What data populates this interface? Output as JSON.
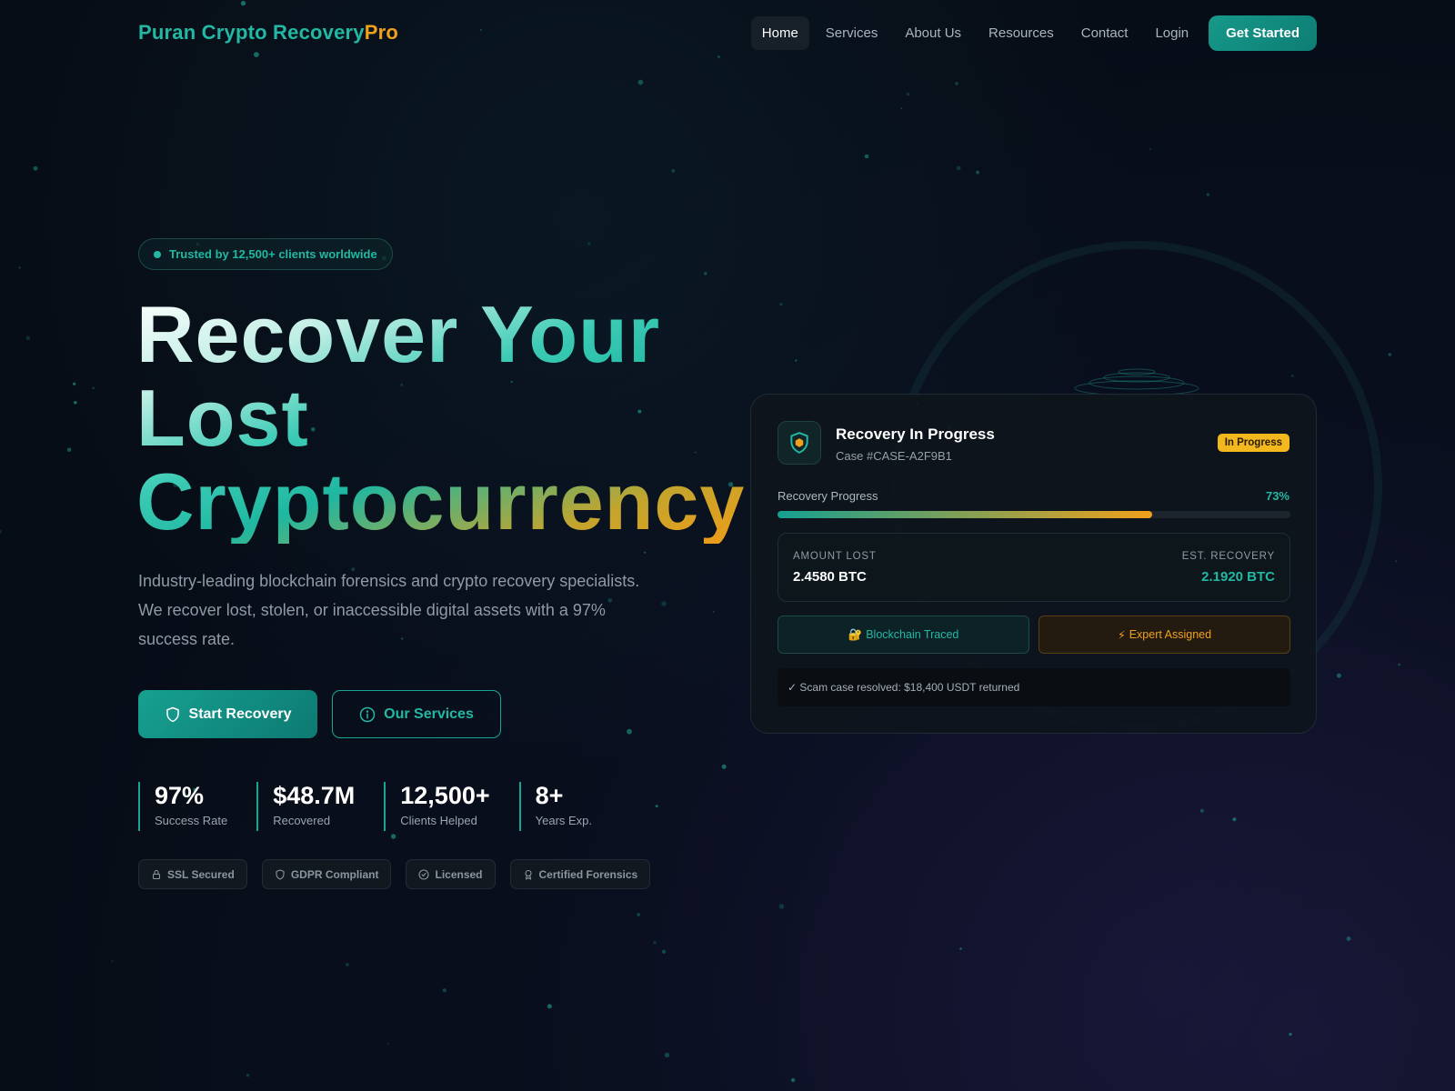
{
  "brand": {
    "name": "Puran Crypto Recovery",
    "suffix": "Pro"
  },
  "nav": {
    "links": [
      "Home",
      "Services",
      "About Us",
      "Resources",
      "Contact",
      "Login"
    ],
    "active": "Home",
    "cta": "Get Started"
  },
  "hero": {
    "trust_badge": "Trusted by 12,500+ clients worldwide",
    "headline_lines": [
      "Recover Your",
      "Lost",
      "Cryptocurrency"
    ],
    "subtext": "Industry-leading blockchain forensics and crypto recovery specialists. We recover lost, stolen, or inaccessible digital assets with a 97% success rate.",
    "primary_button": "Start Recovery",
    "secondary_button": "Our Services"
  },
  "stats": [
    {
      "value": "97%",
      "label": "Success Rate"
    },
    {
      "value": "$48.7M",
      "label": "Recovered"
    },
    {
      "value": "12,500+",
      "label": "Clients Helped"
    },
    {
      "value": "8+",
      "label": "Years Exp."
    }
  ],
  "trust_badges": [
    "SSL Secured",
    "GDPR Compliant",
    "Licensed",
    "Certified Forensics"
  ],
  "recovery_card": {
    "title": "Recovery In Progress",
    "case_id": "Case #CASE-A2F9B1",
    "status": "In Progress",
    "progress_label": "Recovery Progress",
    "progress_percent": 73,
    "progress_text": "73%",
    "amount_lost_label": "AMOUNT LOST",
    "amount_lost": "2.4580 BTC",
    "est_recovery_label": "EST. RECOVERY",
    "est_recovery": "2.1920 BTC",
    "chip_traced": "Blockchain Traced",
    "chip_expert": "Expert Assigned",
    "resolved_note": "Scam case resolved: $18,400 USDT returned"
  },
  "colors": {
    "accent": "#22b8a3",
    "brand_highlight": "#f0a11b",
    "status": "#f2b81d",
    "background": "#070d17"
  },
  "icons": {
    "primary_button": "shield-icon",
    "secondary_button": "info-icon",
    "card": "shield-coin-icon",
    "traced": "lock-icon",
    "expert": "lightning-icon",
    "resolved": "check-icon"
  }
}
